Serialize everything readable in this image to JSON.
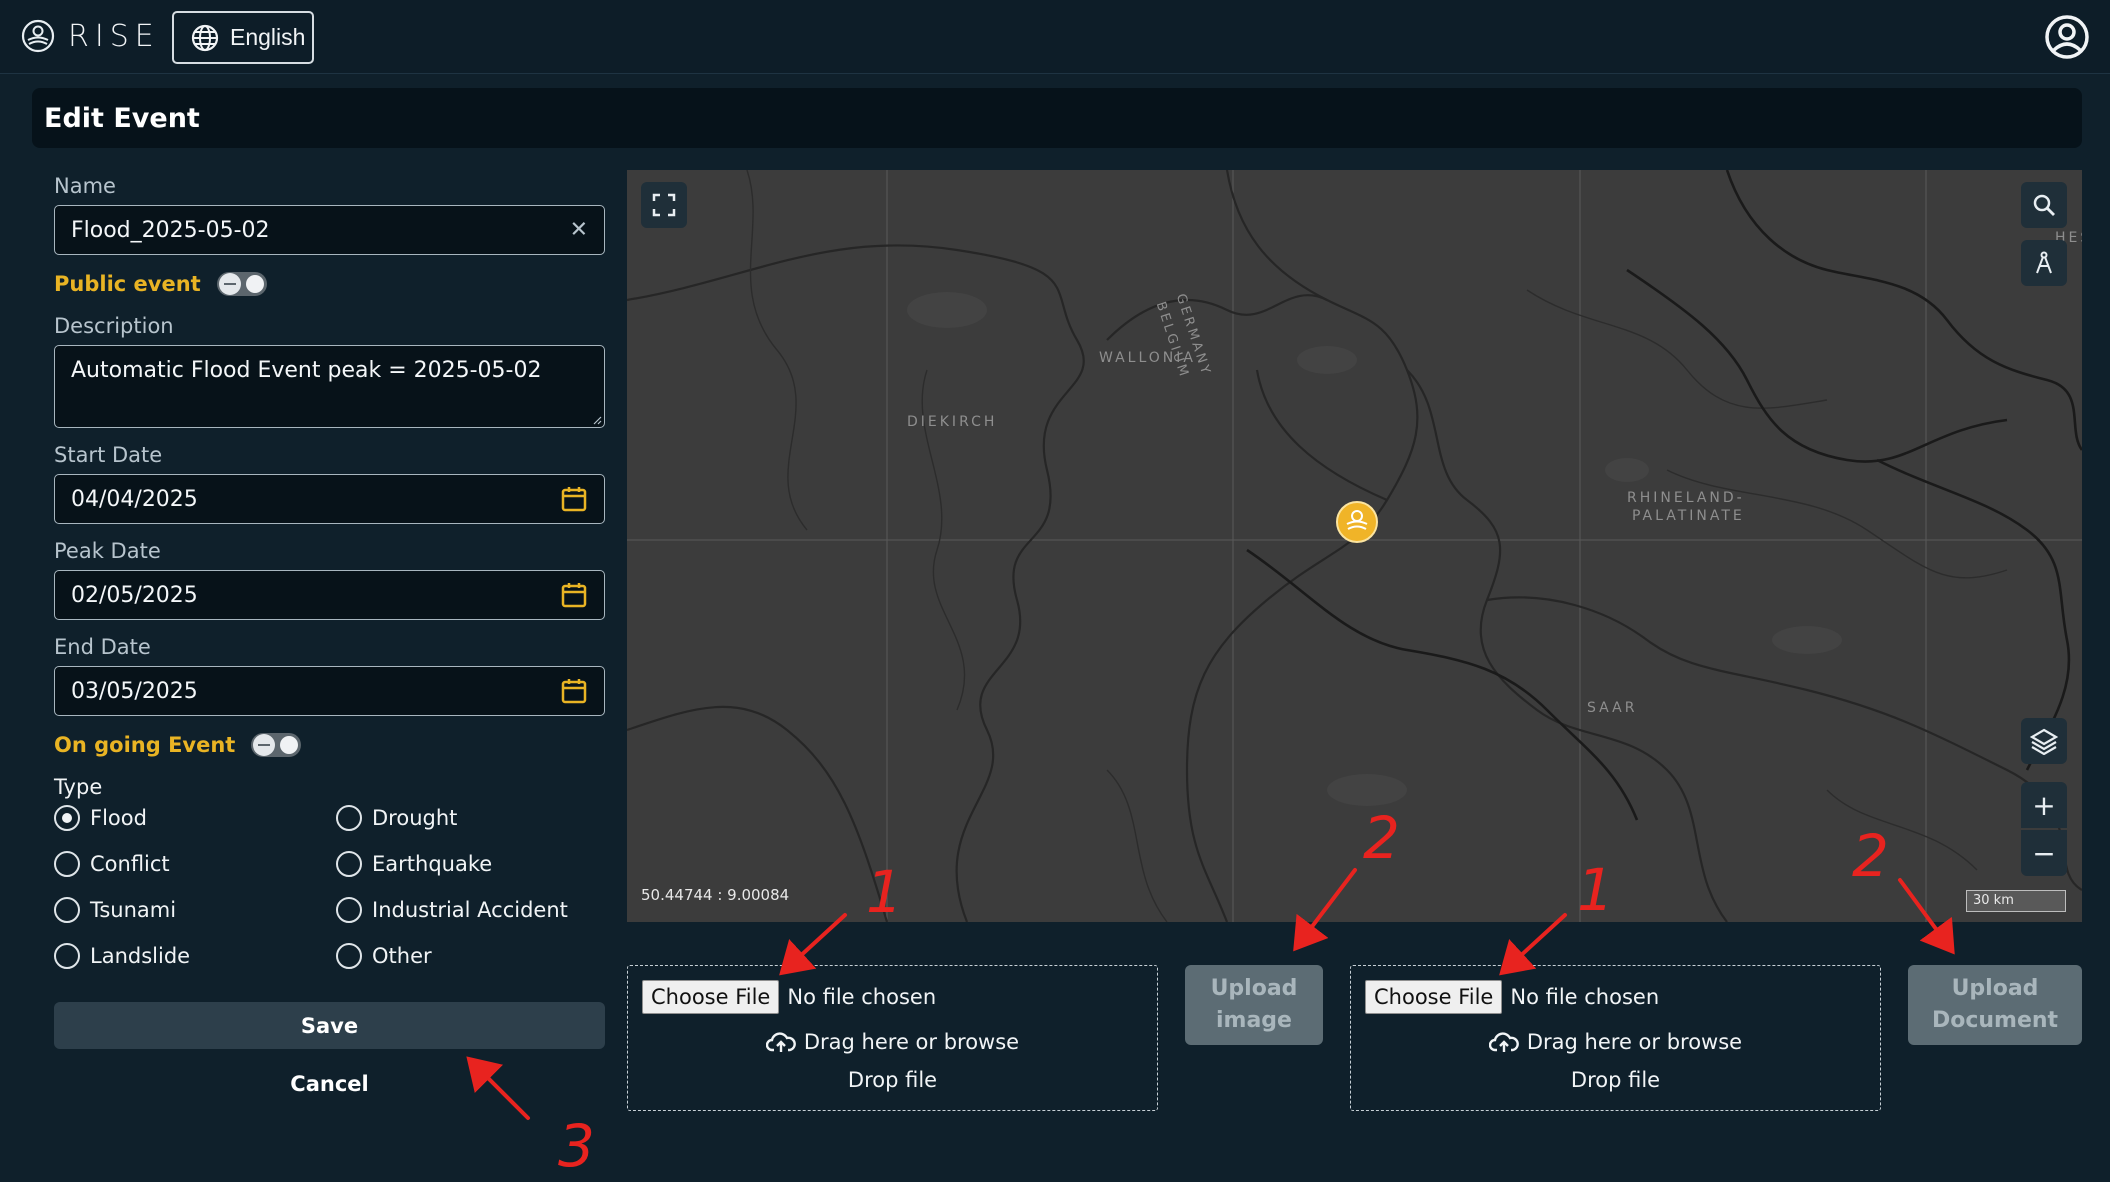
{
  "app": {
    "logo_text": "RISE",
    "language_label": "English"
  },
  "page": {
    "title": "Edit Event"
  },
  "form": {
    "name_label": "Name",
    "name_value": "Flood_2025-05-02",
    "clear_glyph": "✕",
    "public_event_label": "Public event",
    "public_event_on": false,
    "description_label": "Description",
    "description_value": "Automatic Flood Event peak = 2025-05-02",
    "start_date_label": "Start Date",
    "start_date_value": "04/04/2025",
    "peak_date_label": "Peak Date",
    "peak_date_value": "02/05/2025",
    "end_date_label": "End Date",
    "end_date_value": "03/05/2025",
    "ongoing_label": "On going Event",
    "ongoing_on": false,
    "type_label": "Type",
    "types": [
      {
        "label": "Flood",
        "selected": true
      },
      {
        "label": "Drought",
        "selected": false
      },
      {
        "label": "Conflict",
        "selected": false
      },
      {
        "label": "Earthquake",
        "selected": false
      },
      {
        "label": "Tsunami",
        "selected": false
      },
      {
        "label": "Industrial Accident",
        "selected": false
      },
      {
        "label": "Landslide",
        "selected": false
      },
      {
        "label": "Other",
        "selected": false
      }
    ],
    "save_label": "Save",
    "cancel_label": "Cancel"
  },
  "map": {
    "coordinates": "50.44744 : 9.00084",
    "scale_label": "30 km",
    "region_labels": {
      "wallonia": "WALLONIA",
      "germany": "GERMANY",
      "belgium": "BELGIUM",
      "diekirch": "DIEKIRCH",
      "rhineland": "RHINELAND-",
      "palatinate": "PALATINATE",
      "saar": "SAAR",
      "hes": "HES"
    },
    "zoom_in": "+",
    "zoom_out": "−"
  },
  "uploads": {
    "image": {
      "choose_label": "Choose File",
      "no_file": "No file chosen",
      "drag_text": "Drag here or browse",
      "drop_text": "Drop file",
      "button_line1": "Upload",
      "button_line2": "image"
    },
    "document": {
      "choose_label": "Choose File",
      "no_file": "No file chosen",
      "drag_text": "Drag here or browse",
      "drop_text": "Drop file",
      "button_line1": "Upload",
      "button_line2": "Document"
    }
  },
  "annotations": {
    "step1": "1",
    "step2": "2",
    "step3": "3"
  },
  "colors": {
    "accent": "#e9b424",
    "annotation": "#e8231f",
    "background": "#0f202b"
  }
}
